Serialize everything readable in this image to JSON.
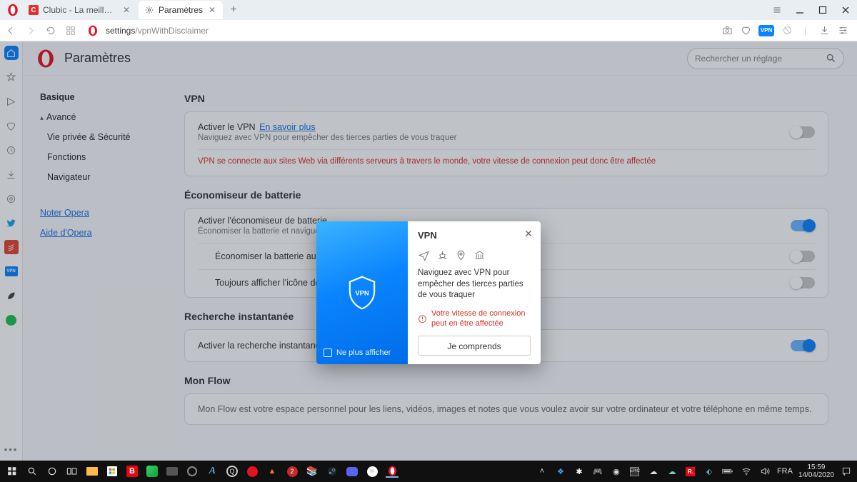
{
  "tabs": [
    {
      "title": "Clubic - La meilleure source",
      "favicon": "C"
    },
    {
      "title": "Paramètres"
    }
  ],
  "address_bar": {
    "url_main": "settings",
    "url_path": "/vpnWithDisclaimer",
    "vpn_badge": "VPN"
  },
  "page": {
    "title": "Paramètres",
    "search_placeholder": "Rechercher un réglage"
  },
  "nav": {
    "basic": "Basique",
    "advanced": "Avancé",
    "privacy": "Vie privée & Sécurité",
    "features": "Fonctions",
    "browser": "Navigateur",
    "rate": "Noter Opera",
    "help": "Aide d'Opera"
  },
  "sections": {
    "vpn": {
      "title": "VPN",
      "enable_label": "Activer le VPN",
      "learn_more": "En savoir plus",
      "desc": "Naviguez avec VPN pour empêcher des tierces parties de vous traquer",
      "warn": "VPN se connecte aux sites Web via différents serveurs à travers le monde, votre vitesse de connexion peut donc être affectée"
    },
    "battery": {
      "title": "Économiseur de batterie",
      "enable_label": "Activer l'économiseur de batterie",
      "enable_desc": "Économiser la batterie et naviguer jusqu'à",
      "auto_label": "Économiser la batterie autom",
      "icon_label": "Toujours afficher l'icône de la"
    },
    "instant": {
      "title": "Recherche instantanée",
      "enable_label": "Activer la recherche instantanée"
    },
    "flow": {
      "title": "Mon Flow",
      "desc": "Mon Flow est votre espace personnel pour les liens, vidéos, images et notes que vous voulez avoir sur votre ordinateur et votre téléphone en même temps."
    }
  },
  "dialog": {
    "title": "VPN",
    "body": "Naviguez avec VPN pour empêcher des tierces parties de vous traquer",
    "warn": "Votre vitesse de connexion peut en être affectée",
    "button": "Je comprends",
    "dont_show": "Ne plus afficher",
    "shield_label": "VPN"
  },
  "taskbar": {
    "lang": "FRA",
    "time": "15:59",
    "date": "14/04/2020"
  }
}
